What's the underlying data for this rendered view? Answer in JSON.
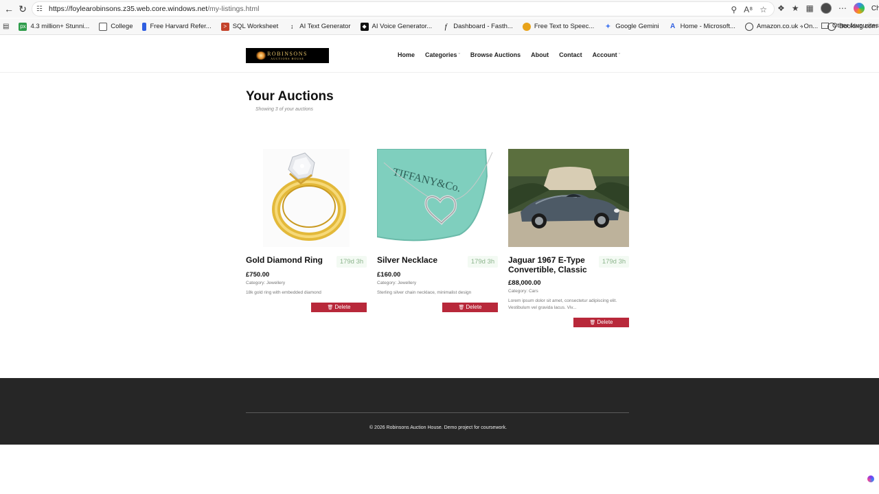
{
  "browser": {
    "url_host": "https://foylearobinsons.z35.web.core.windows.net",
    "url_path": "/my-listings.html",
    "chat_label": "Chat"
  },
  "bookmarks": [
    {
      "label": "4.3 million+ Stunni...",
      "icon": "px-icon",
      "color": "#2e9c4a"
    },
    {
      "label": "College",
      "icon": "folder-icon",
      "color": ""
    },
    {
      "label": "Free Harvard Refer...",
      "icon": "bookmark-icon",
      "color": "#2f5ee0"
    },
    {
      "label": "SQL Worksheet",
      "icon": "sql-icon",
      "color": "#c4432b"
    },
    {
      "label": "AI Text Generator",
      "icon": "ai-icon",
      "color": ""
    },
    {
      "label": "AI Voice Generator...",
      "icon": "voice-icon",
      "color": "#111111"
    },
    {
      "label": "Dashboard - Fasth...",
      "icon": "f-icon",
      "color": ""
    },
    {
      "label": "Free Text to Speec...",
      "icon": "speech-icon",
      "color": "#e8a31a"
    },
    {
      "label": "Google Gemini",
      "icon": "gemini-icon",
      "color": ""
    },
    {
      "label": "Home - Microsoft...",
      "icon": "microsoft-icon",
      "color": "#2f5ee0"
    },
    {
      "label": "Amazon.co.uk - On...",
      "icon": "globe-icon",
      "color": ""
    },
    {
      "label": "Booking.com",
      "icon": "globe-icon",
      "color": ""
    }
  ],
  "other_favourites": "Other favourites",
  "site": {
    "logo_text": "ROBINSONS",
    "logo_sub": "AUCTIONS HOUSE",
    "nav": {
      "home": "Home",
      "categories": "Categories",
      "browse": "Browse Auctions",
      "about": "About",
      "contact": "Contact",
      "account": "Account"
    }
  },
  "main": {
    "title": "Your Auctions",
    "subtitle": "Showing 3 of your auctions"
  },
  "listings": [
    {
      "title": "Gold Diamond Ring",
      "timer": "179d 3h",
      "price": "£750.00",
      "category": "Category: Jewellery",
      "description": "18k gold ring with embedded diamond",
      "delete_label": "Delete"
    },
    {
      "title": "Silver Necklace",
      "timer": "179d 3h",
      "price": "£160.00",
      "category": "Category: Jewellery",
      "description": "Sterling silver chain necklace, minimalist design",
      "delete_label": "Delete"
    },
    {
      "title": "Jaguar 1967 E-Type Convertible, Classic",
      "timer": "179d 3h",
      "price": "£88,000.00",
      "category": "Category: Cars",
      "description": "Lorem ipsum dolor sit amet, consectetur adipiscing elit. Vestibulum vel gravida lacus. Viv...",
      "delete_label": "Delete"
    }
  ],
  "footer": {
    "copyright": "© 2026 Robinsons Auction House. Demo project for coursework."
  },
  "colors": {
    "delete_button": "#b8283a",
    "footer_bg": "#262626",
    "timer_text": "#8db58d"
  }
}
